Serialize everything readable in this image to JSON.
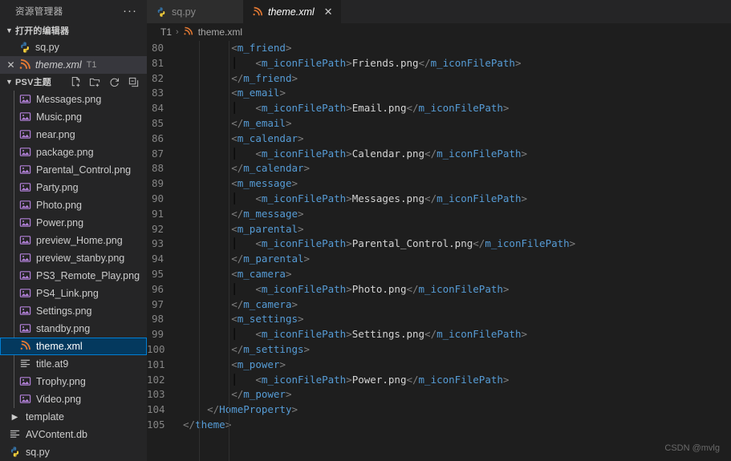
{
  "sidebar": {
    "title": "资源管理器",
    "more_label": "···",
    "open_editors": {
      "label": "打开的编辑器",
      "items": [
        {
          "name": "sq.py",
          "icon": "python-file-icon",
          "italic": false,
          "suffix": "",
          "has_close": false,
          "active": false
        },
        {
          "name": "theme.xml",
          "icon": "xml-file-icon",
          "italic": true,
          "suffix": "T1",
          "has_close": true,
          "active": true
        }
      ]
    },
    "project": {
      "label": "PSV主题",
      "actions": [
        {
          "name": "new-file-icon",
          "title": "新建文件"
        },
        {
          "name": "new-folder-icon",
          "title": "新建文件夹"
        },
        {
          "name": "refresh-icon",
          "title": "刷新"
        },
        {
          "name": "collapse-all-icon",
          "title": "折叠文件夹"
        }
      ],
      "files": [
        {
          "name": "Messages.png",
          "icon": "image-file-icon",
          "depth": 1,
          "selected": false
        },
        {
          "name": "Music.png",
          "icon": "image-file-icon",
          "depth": 1,
          "selected": false
        },
        {
          "name": "near.png",
          "icon": "image-file-icon",
          "depth": 1,
          "selected": false
        },
        {
          "name": "package.png",
          "icon": "image-file-icon",
          "depth": 1,
          "selected": false
        },
        {
          "name": "Parental_Control.png",
          "icon": "image-file-icon",
          "depth": 1,
          "selected": false
        },
        {
          "name": "Party.png",
          "icon": "image-file-icon",
          "depth": 1,
          "selected": false
        },
        {
          "name": "Photo.png",
          "icon": "image-file-icon",
          "depth": 1,
          "selected": false
        },
        {
          "name": "Power.png",
          "icon": "image-file-icon",
          "depth": 1,
          "selected": false
        },
        {
          "name": "preview_Home.png",
          "icon": "image-file-icon",
          "depth": 1,
          "selected": false
        },
        {
          "name": "preview_stanby.png",
          "icon": "image-file-icon",
          "depth": 1,
          "selected": false
        },
        {
          "name": "PS3_Remote_Play.png",
          "icon": "image-file-icon",
          "depth": 1,
          "selected": false
        },
        {
          "name": "PS4_Link.png",
          "icon": "image-file-icon",
          "depth": 1,
          "selected": false
        },
        {
          "name": "Settings.png",
          "icon": "image-file-icon",
          "depth": 1,
          "selected": false
        },
        {
          "name": "standby.png",
          "icon": "image-file-icon",
          "depth": 1,
          "selected": false
        },
        {
          "name": "theme.xml",
          "icon": "xml-file-icon",
          "depth": 1,
          "selected": true
        },
        {
          "name": "title.at9",
          "icon": "generic-file-icon",
          "depth": 1,
          "selected": false
        },
        {
          "name": "Trophy.png",
          "icon": "image-file-icon",
          "depth": 1,
          "selected": false
        },
        {
          "name": "Video.png",
          "icon": "image-file-icon",
          "depth": 1,
          "selected": false
        },
        {
          "name": "template",
          "icon": "folder-collapsed-icon",
          "depth": 0,
          "selected": false
        },
        {
          "name": "AVContent.db",
          "icon": "generic-file-icon",
          "depth": 0,
          "selected": false
        },
        {
          "name": "sq.py",
          "icon": "python-file-icon",
          "depth": 0,
          "selected": false
        }
      ]
    }
  },
  "tabs": [
    {
      "label": "sq.py",
      "icon": "python-file-icon",
      "active": false,
      "italic": false,
      "closable": false
    },
    {
      "label": "theme.xml",
      "icon": "xml-file-icon",
      "active": true,
      "italic": true,
      "closable": true,
      "close_label": "✕"
    }
  ],
  "breadcrumb": {
    "root": "T1",
    "separator": "›",
    "file": "theme.xml",
    "file_icon": "xml-file-icon"
  },
  "code": {
    "language": "xml",
    "first_line": 80,
    "lines": [
      {
        "n": "80",
        "tokens": [
          {
            "t": "ind",
            "v": "        "
          },
          {
            "t": "punct",
            "v": "<"
          },
          {
            "t": "tag",
            "v": "m_friend"
          },
          {
            "t": "punct",
            "v": ">"
          }
        ]
      },
      {
        "n": "81",
        "tokens": [
          {
            "t": "ind",
            "v": "        │   "
          },
          {
            "t": "punct",
            "v": "<"
          },
          {
            "t": "tag",
            "v": "m_iconFilePath"
          },
          {
            "t": "punct",
            "v": ">"
          },
          {
            "t": "text",
            "v": "Friends.png"
          },
          {
            "t": "punct",
            "v": "</"
          },
          {
            "t": "tag",
            "v": "m_iconFilePath"
          },
          {
            "t": "punct",
            "v": ">"
          }
        ]
      },
      {
        "n": "82",
        "tokens": [
          {
            "t": "ind",
            "v": "        "
          },
          {
            "t": "punct",
            "v": "</"
          },
          {
            "t": "tag",
            "v": "m_friend"
          },
          {
            "t": "punct",
            "v": ">"
          }
        ]
      },
      {
        "n": "83",
        "tokens": [
          {
            "t": "ind",
            "v": "        "
          },
          {
            "t": "punct",
            "v": "<"
          },
          {
            "t": "tag",
            "v": "m_email"
          },
          {
            "t": "punct",
            "v": ">"
          }
        ]
      },
      {
        "n": "84",
        "tokens": [
          {
            "t": "ind",
            "v": "        │   "
          },
          {
            "t": "punct",
            "v": "<"
          },
          {
            "t": "tag",
            "v": "m_iconFilePath"
          },
          {
            "t": "punct",
            "v": ">"
          },
          {
            "t": "text",
            "v": "Email.png"
          },
          {
            "t": "punct",
            "v": "</"
          },
          {
            "t": "tag",
            "v": "m_iconFilePath"
          },
          {
            "t": "punct",
            "v": ">"
          }
        ]
      },
      {
        "n": "85",
        "tokens": [
          {
            "t": "ind",
            "v": "        "
          },
          {
            "t": "punct",
            "v": "</"
          },
          {
            "t": "tag",
            "v": "m_email"
          },
          {
            "t": "punct",
            "v": ">"
          }
        ]
      },
      {
        "n": "86",
        "tokens": [
          {
            "t": "ind",
            "v": "        "
          },
          {
            "t": "punct",
            "v": "<"
          },
          {
            "t": "tag",
            "v": "m_calendar"
          },
          {
            "t": "punct",
            "v": ">"
          }
        ]
      },
      {
        "n": "87",
        "tokens": [
          {
            "t": "ind",
            "v": "        │   "
          },
          {
            "t": "punct",
            "v": "<"
          },
          {
            "t": "tag",
            "v": "m_iconFilePath"
          },
          {
            "t": "punct",
            "v": ">"
          },
          {
            "t": "text",
            "v": "Calendar.png"
          },
          {
            "t": "punct",
            "v": "</"
          },
          {
            "t": "tag",
            "v": "m_iconFilePath"
          },
          {
            "t": "punct",
            "v": ">"
          }
        ]
      },
      {
        "n": "88",
        "tokens": [
          {
            "t": "ind",
            "v": "        "
          },
          {
            "t": "punct",
            "v": "</"
          },
          {
            "t": "tag",
            "v": "m_calendar"
          },
          {
            "t": "punct",
            "v": ">"
          }
        ]
      },
      {
        "n": "89",
        "tokens": [
          {
            "t": "ind",
            "v": "        "
          },
          {
            "t": "punct",
            "v": "<"
          },
          {
            "t": "tag",
            "v": "m_message"
          },
          {
            "t": "punct",
            "v": ">"
          }
        ]
      },
      {
        "n": "90",
        "tokens": [
          {
            "t": "ind",
            "v": "        │   "
          },
          {
            "t": "punct",
            "v": "<"
          },
          {
            "t": "tag",
            "v": "m_iconFilePath"
          },
          {
            "t": "punct",
            "v": ">"
          },
          {
            "t": "text",
            "v": "Messages.png"
          },
          {
            "t": "punct",
            "v": "</"
          },
          {
            "t": "tag",
            "v": "m_iconFilePath"
          },
          {
            "t": "punct",
            "v": ">"
          }
        ]
      },
      {
        "n": "91",
        "tokens": [
          {
            "t": "ind",
            "v": "        "
          },
          {
            "t": "punct",
            "v": "</"
          },
          {
            "t": "tag",
            "v": "m_message"
          },
          {
            "t": "punct",
            "v": ">"
          }
        ]
      },
      {
        "n": "92",
        "tokens": [
          {
            "t": "ind",
            "v": "        "
          },
          {
            "t": "punct",
            "v": "<"
          },
          {
            "t": "tag",
            "v": "m_parental"
          },
          {
            "t": "punct",
            "v": ">"
          }
        ]
      },
      {
        "n": "93",
        "tokens": [
          {
            "t": "ind",
            "v": "        │   "
          },
          {
            "t": "punct",
            "v": "<"
          },
          {
            "t": "tag",
            "v": "m_iconFilePath"
          },
          {
            "t": "punct",
            "v": ">"
          },
          {
            "t": "text",
            "v": "Parental_Control.png"
          },
          {
            "t": "punct",
            "v": "</"
          },
          {
            "t": "tag",
            "v": "m_iconFilePath"
          },
          {
            "t": "punct",
            "v": ">"
          }
        ]
      },
      {
        "n": "94",
        "tokens": [
          {
            "t": "ind",
            "v": "        "
          },
          {
            "t": "punct",
            "v": "</"
          },
          {
            "t": "tag",
            "v": "m_parental"
          },
          {
            "t": "punct",
            "v": ">"
          }
        ]
      },
      {
        "n": "95",
        "tokens": [
          {
            "t": "ind",
            "v": "        "
          },
          {
            "t": "punct",
            "v": "<"
          },
          {
            "t": "tag",
            "v": "m_camera"
          },
          {
            "t": "punct",
            "v": ">"
          }
        ]
      },
      {
        "n": "96",
        "tokens": [
          {
            "t": "ind",
            "v": "        │   "
          },
          {
            "t": "punct",
            "v": "<"
          },
          {
            "t": "tag",
            "v": "m_iconFilePath"
          },
          {
            "t": "punct",
            "v": ">"
          },
          {
            "t": "text",
            "v": "Photo.png"
          },
          {
            "t": "punct",
            "v": "</"
          },
          {
            "t": "tag",
            "v": "m_iconFilePath"
          },
          {
            "t": "punct",
            "v": ">"
          }
        ]
      },
      {
        "n": "97",
        "tokens": [
          {
            "t": "ind",
            "v": "        "
          },
          {
            "t": "punct",
            "v": "</"
          },
          {
            "t": "tag",
            "v": "m_camera"
          },
          {
            "t": "punct",
            "v": ">"
          }
        ]
      },
      {
        "n": "98",
        "tokens": [
          {
            "t": "ind",
            "v": "        "
          },
          {
            "t": "punct",
            "v": "<"
          },
          {
            "t": "tag",
            "v": "m_settings"
          },
          {
            "t": "punct",
            "v": ">"
          }
        ]
      },
      {
        "n": "99",
        "tokens": [
          {
            "t": "ind",
            "v": "        │   "
          },
          {
            "t": "punct",
            "v": "<"
          },
          {
            "t": "tag",
            "v": "m_iconFilePath"
          },
          {
            "t": "punct",
            "v": ">"
          },
          {
            "t": "text",
            "v": "Settings.png"
          },
          {
            "t": "punct",
            "v": "</"
          },
          {
            "t": "tag",
            "v": "m_iconFilePath"
          },
          {
            "t": "punct",
            "v": ">"
          }
        ]
      },
      {
        "n": "100",
        "tokens": [
          {
            "t": "ind",
            "v": "        "
          },
          {
            "t": "punct",
            "v": "</"
          },
          {
            "t": "tag",
            "v": "m_settings"
          },
          {
            "t": "punct",
            "v": ">"
          }
        ]
      },
      {
        "n": "101",
        "tokens": [
          {
            "t": "ind",
            "v": "        "
          },
          {
            "t": "punct",
            "v": "<"
          },
          {
            "t": "tag",
            "v": "m_power"
          },
          {
            "t": "punct",
            "v": ">"
          }
        ]
      },
      {
        "n": "102",
        "tokens": [
          {
            "t": "ind",
            "v": "        │   "
          },
          {
            "t": "punct",
            "v": "<"
          },
          {
            "t": "tag",
            "v": "m_iconFilePath"
          },
          {
            "t": "punct",
            "v": ">"
          },
          {
            "t": "text",
            "v": "Power.png"
          },
          {
            "t": "punct",
            "v": "</"
          },
          {
            "t": "tag",
            "v": "m_iconFilePath"
          },
          {
            "t": "punct",
            "v": ">"
          }
        ]
      },
      {
        "n": "103",
        "tokens": [
          {
            "t": "ind",
            "v": "        "
          },
          {
            "t": "punct",
            "v": "</"
          },
          {
            "t": "tag",
            "v": "m_power"
          },
          {
            "t": "punct",
            "v": ">"
          }
        ]
      },
      {
        "n": "104",
        "tokens": [
          {
            "t": "ind",
            "v": "    "
          },
          {
            "t": "punct",
            "v": "</"
          },
          {
            "t": "tag",
            "v": "HomeProperty"
          },
          {
            "t": "punct",
            "v": ">"
          }
        ]
      },
      {
        "n": "105",
        "tokens": [
          {
            "t": "ind",
            "v": ""
          },
          {
            "t": "punct",
            "v": "</"
          },
          {
            "t": "tag",
            "v": "theme"
          },
          {
            "t": "punct",
            "v": ">"
          }
        ]
      }
    ]
  },
  "watermark": "CSDN @mvlg",
  "colors": {
    "sidebar_bg": "#252526",
    "editor_bg": "#1e1e1e",
    "selection_bg": "#04395e",
    "selection_border": "#007fd4",
    "tag": "#569cd6",
    "punct": "#808080",
    "text": "#d4d4d4",
    "linenum": "#858585",
    "image_icon": "#b180d7",
    "xml_icon": "#e37933",
    "python_icon": "#3572a5"
  }
}
